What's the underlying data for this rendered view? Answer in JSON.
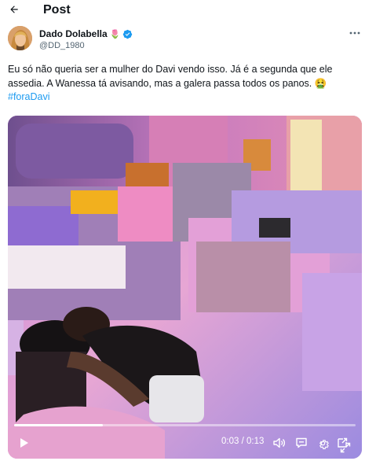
{
  "header": {
    "title": "Post"
  },
  "author": {
    "name": "Dado Dolabella",
    "emoji": "🌷",
    "handle": "@DD_1980"
  },
  "tweet": {
    "text": "Eu só não queria ser a mulher do Davi vendo isso. Já é a segunda que ele assedia. A Wanessa tá avisando, mas a galera passa todos os panos. 🤮",
    "hashtag": "#foraDavi"
  },
  "video": {
    "current_time": "0:03",
    "separator": " / ",
    "duration": "0:13",
    "progress": 0.26
  },
  "icons": {
    "back": "arrow-left-icon",
    "verified": "verified-badge-icon",
    "more": "more-horizontal-icon",
    "play": "play-icon",
    "volume": "volume-icon",
    "captions": "captions-icon",
    "settings": "gear-icon",
    "pip": "picture-in-picture-icon",
    "fullscreen": "fullscreen-icon"
  },
  "colors": {
    "accent": "#1d9bf0",
    "text": "#0f1419",
    "secondary": "#536471"
  }
}
